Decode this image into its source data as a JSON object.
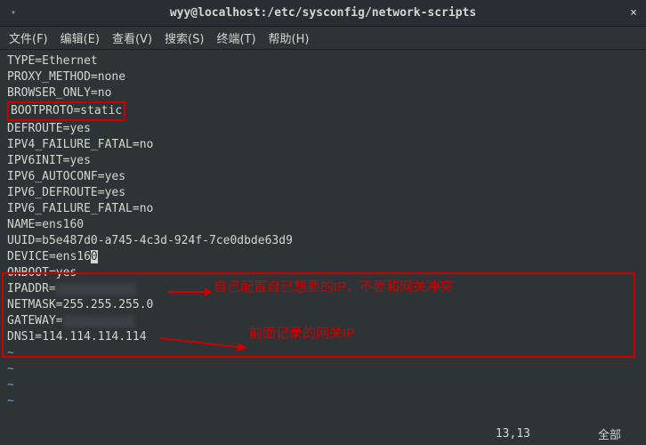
{
  "titlebar": {
    "title": "wyy@localhost:/etc/sysconfig/network-scripts"
  },
  "menubar": {
    "file": "文件(F)",
    "edit": "编辑(E)",
    "view": "查看(V)",
    "search": "搜索(S)",
    "terminal": "终端(T)",
    "help": "帮助(H)"
  },
  "content": {
    "l1": "TYPE=Ethernet",
    "l2": "PROXY_METHOD=none",
    "l3": "BROWSER_ONLY=no",
    "l4": "BOOTPROTO=static",
    "l5": "DEFROUTE=yes",
    "l6": "IPV4_FAILURE_FATAL=no",
    "l7": "IPV6INIT=yes",
    "l8": "IPV6_AUTOCONF=yes",
    "l9": "IPV6_DEFROUTE=yes",
    "l10": "IPV6_FAILURE_FATAL=no",
    "l11": "NAME=ens160",
    "l12": "UUID=b5e487d0-a745-4c3d-924f-7ce0dbde63d9",
    "l13a": "DEVICE=ens16",
    "l13b": "0",
    "l14": "ONBOOT=yes",
    "l15": "IPADDR=",
    "l16": "NETMASK=255.255.255.0",
    "l17": "GATEWAY=",
    "l18": "DNS1=114.114.114.114",
    "tilde": "~"
  },
  "annotations": {
    "a1": "自己配置自己想要的IP，不要和网关冲突",
    "a2": "前面记录的网关IP"
  },
  "status": {
    "position": "13,13",
    "mode": "全部"
  }
}
